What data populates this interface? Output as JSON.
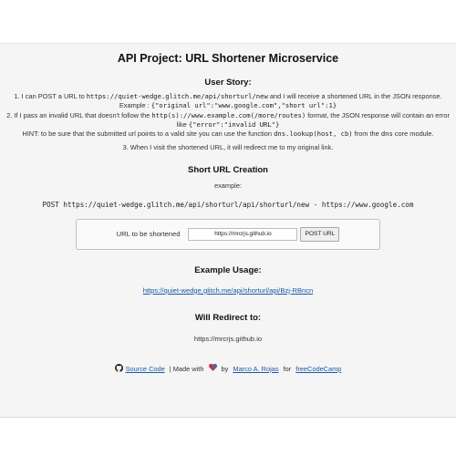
{
  "header": {
    "title": "API Project: URL Shortener Microservice"
  },
  "story": {
    "title": "User Story:",
    "item1_prefix": "1. I can POST a URL to ",
    "item1_code": "https://quiet-wedge.glitch.me/api/shorturl/new",
    "item1_suffix": " and I will receive a shortened URL in the JSON response.",
    "item1_example_prefix": "Example : ",
    "item1_example_code": "{\"original url\":\"www.google.com\",\"short url\":1}",
    "item2_prefix": "2. If I pass an invalid URL that doesn't follow the ",
    "item2_code": "http(s)://www.example.com(/more/routes)",
    "item2_middle": " format, the JSON response will contain an error like ",
    "item2_error_code": "{\"error\":\"invalid URL\"}",
    "hint_prefix": "HINT: to be sure that the submitted url points to a valid site you can use the function ",
    "hint_code": "dns.lookup(host, cb)",
    "hint_middle": " from the ",
    "hint_code2": "dns",
    "hint_suffix": " core module.",
    "item3": "3. When I visit the shortened URL, it will redirect me to my original link."
  },
  "creation": {
    "title": "Short URL Creation",
    "example_label": "example:",
    "post_example": "POST https://quiet-wedge.glitch.me/api/shorturl/api/shorturl/new - https://www.google.com"
  },
  "form": {
    "label": "URL to be shortened",
    "input_value": "https://mrcrjs.github.io",
    "submit_label": "POST URL"
  },
  "usage": {
    "title": "Example Usage:",
    "link": "https://quiet-wedge.glitch.me/api/shorturl/api/Bzj-RBncn"
  },
  "redirect": {
    "title": "Will Redirect to:",
    "url": "https://mrcrjs.github.io"
  },
  "footer": {
    "source_code_link": "Source Code",
    "made_with": " | Made with ",
    "by": " by ",
    "author_link": "Marco A. Rojas",
    "for_text": " for ",
    "fcc_link": "freeCodeCamp"
  },
  "icons": {
    "github": "github-icon",
    "heart": "heart-icon"
  },
  "colors": {
    "link": "#1a5aa6",
    "band_background": "#f5f5f5"
  }
}
